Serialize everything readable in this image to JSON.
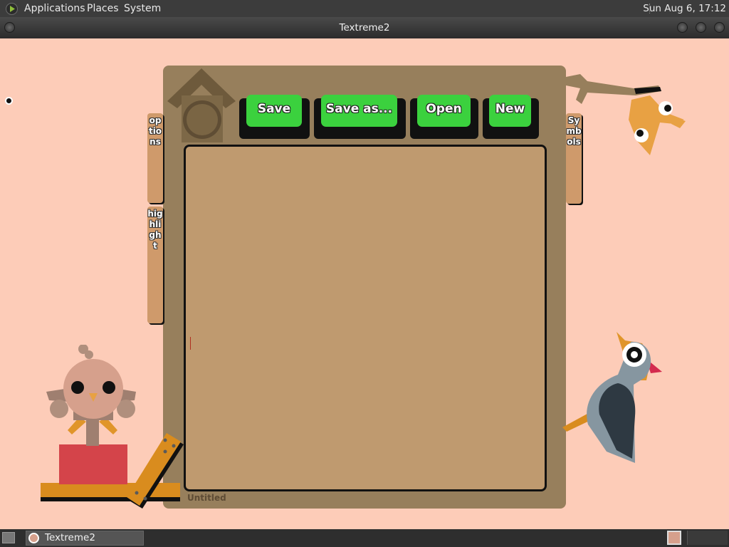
{
  "top_panel": {
    "menus": [
      "Applications",
      "Places",
      "System"
    ],
    "clock": "Sun Aug  6, 17:12"
  },
  "window": {
    "title": "Textreme2"
  },
  "toolbar": {
    "save_label": "Save",
    "save_as_label": "Save as...",
    "open_label": "Open",
    "new_label": "New"
  },
  "side_tabs": {
    "options": "options",
    "highlight": "highlight",
    "symbols": "Symbols"
  },
  "editor": {
    "content": "",
    "filename": "Untitled"
  },
  "taskbar": {
    "task_label": "Textreme2"
  },
  "colors": {
    "background": "#fdccb8",
    "panel": "#977f5c",
    "text_area": "#bf9a6f",
    "button": "#3bd13e"
  }
}
